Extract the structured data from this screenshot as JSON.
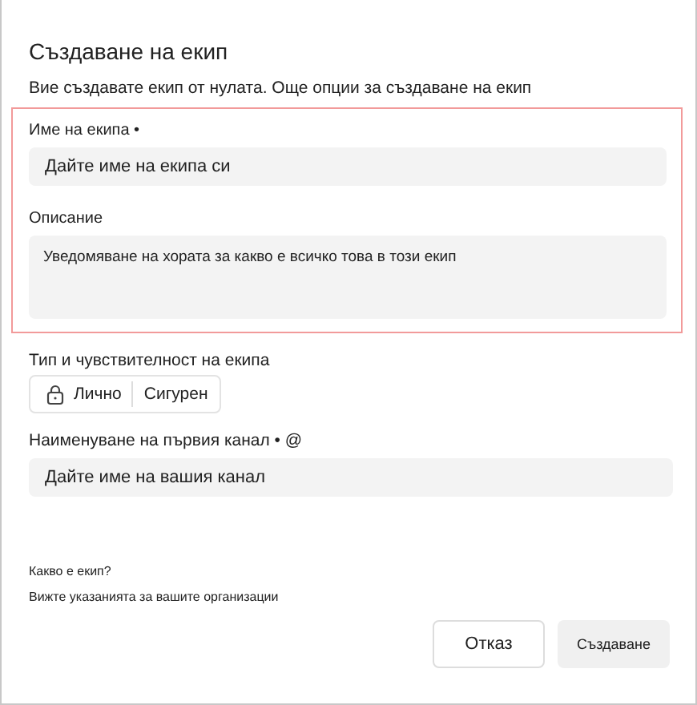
{
  "dialog": {
    "title": "Създаване на екип",
    "subtitle": "Вие създавате екип от нулата. Още опции за създаване на екип"
  },
  "highlighted_fields": [
    {
      "kind": "input",
      "label": "Име на екипа •",
      "placeholder": "Дайте име на екипа си"
    },
    {
      "kind": "textarea",
      "label": "Описание",
      "placeholder": "Уведомяване на хората за какво е всичко това в този екип"
    }
  ],
  "team_type": {
    "label": "Тип и чувствителност на екипа",
    "privacy": "Лично",
    "sensitivity": "Сигурен"
  },
  "channel": {
    "label": "Наименуване на първия канал • @",
    "placeholder": "Дайте име на вашия канал"
  },
  "help": {
    "question": "Какво е екип?",
    "guidance": "Вижте указанията за вашите организации"
  },
  "buttons": [
    {
      "kind": "secondary",
      "label": "Отказ"
    },
    {
      "kind": "primary",
      "label": "Създаване"
    }
  ]
}
